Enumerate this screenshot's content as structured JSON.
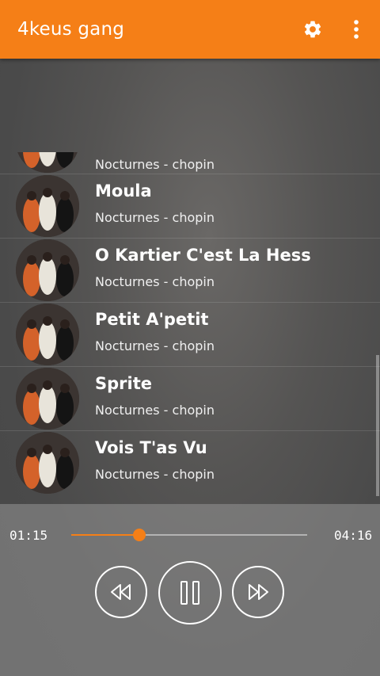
{
  "app": {
    "title": "4keus gang"
  },
  "icons": {
    "settings": "gear-icon",
    "overflow": "more-vert-icon"
  },
  "colors": {
    "accent": "#f57f17",
    "text": "#ffffff"
  },
  "songs": [
    {
      "title": "",
      "subtitle": "Nocturnes - chopin"
    },
    {
      "title": "Moula",
      "subtitle": "Nocturnes - chopin"
    },
    {
      "title": "O Kartier C'est La Hess",
      "subtitle": "Nocturnes - chopin"
    },
    {
      "title": "Petit A'petit",
      "subtitle": "Nocturnes - chopin"
    },
    {
      "title": "Sprite",
      "subtitle": "Nocturnes - chopin"
    },
    {
      "title": "Vois T'as Vu",
      "subtitle": "Nocturnes - chopin"
    }
  ],
  "player": {
    "current_time": "01:15",
    "total_time": "04:16",
    "progress": 0.29,
    "state": "playing"
  }
}
